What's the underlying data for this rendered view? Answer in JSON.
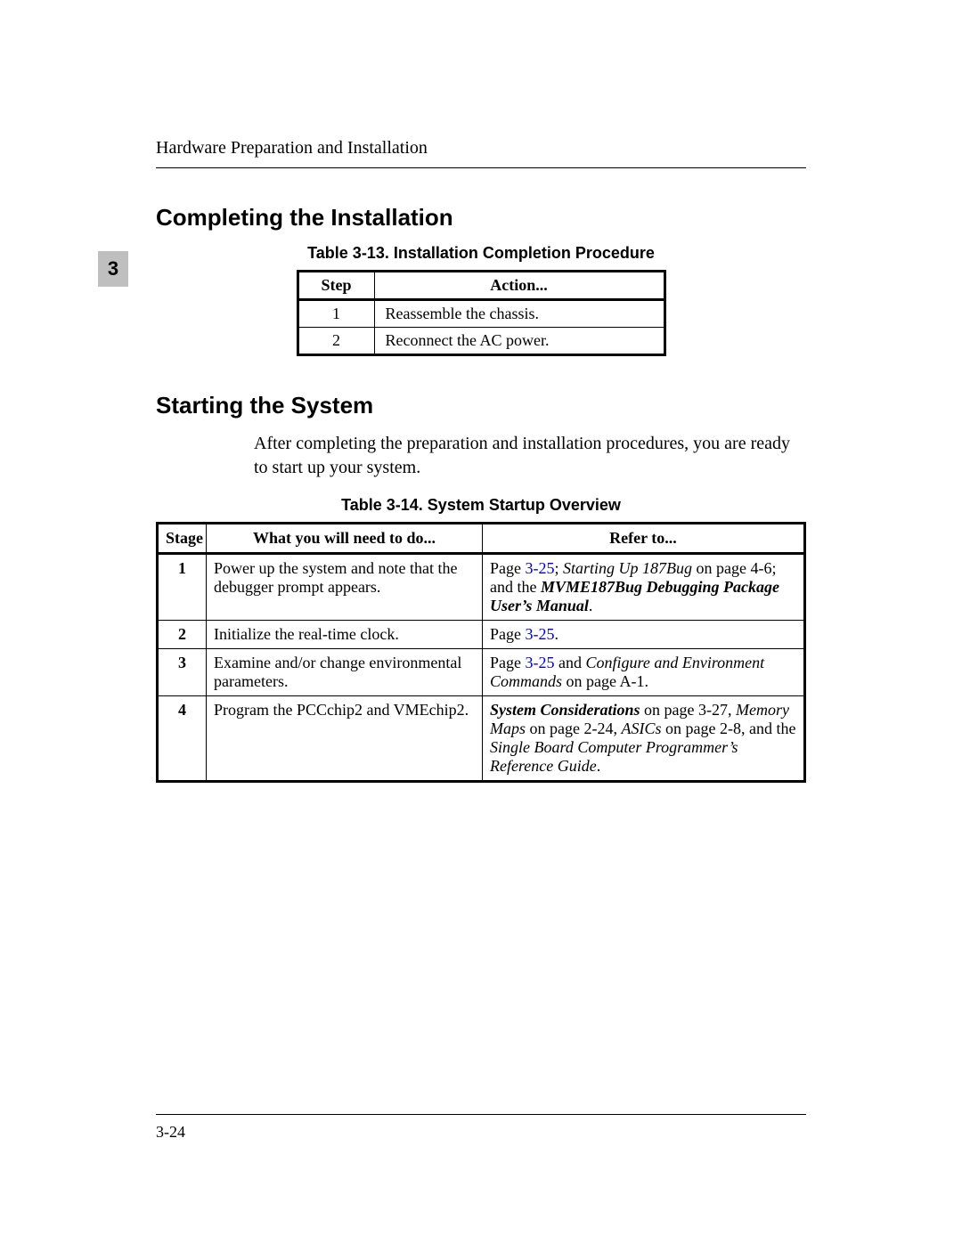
{
  "header": {
    "running_head": "Hardware Preparation and Installation"
  },
  "chapter_tab": "3",
  "section1": "Completing the Installation",
  "table13": {
    "caption": "Table 3-13.  Installation Completion Procedure",
    "head_step": "Step",
    "head_action": "Action...",
    "rows": [
      {
        "step": "1",
        "action": "Reassemble the chassis."
      },
      {
        "step": "2",
        "action": "Reconnect the AC power."
      }
    ]
  },
  "section2": "Starting the System",
  "body2": "After completing the preparation and installation procedures, you are ready to start up your system.",
  "table14": {
    "caption": "Table 3-14.  System Startup Overview",
    "head_stage": "Stage",
    "head_what": "What you will need to do...",
    "head_ref": "Refer to...",
    "rows": [
      {
        "stage": "1",
        "what": "Power up the system and note that the debugger prompt appears.",
        "ref": {
          "t1": "Page ",
          "l1": "3-25",
          "t2": "; ",
          "i1": "Starting Up 187Bug",
          "t3": " on page 4-6; and the ",
          "bi1": "MVME187Bug Debugging Package User’s Manual",
          "t4": "."
        }
      },
      {
        "stage": "2",
        "what": "Initialize the real-time clock.",
        "ref": {
          "t1": "Page ",
          "l1": "3-25",
          "t2": "."
        }
      },
      {
        "stage": "3",
        "what": "Examine and/or change environmental parameters.",
        "ref": {
          "t1": "Page ",
          "l1": "3-25",
          "t2": " and ",
          "i1": "Configure and Environment Commands",
          "t3": " on page A-1."
        }
      },
      {
        "stage": "4",
        "what": "Program the PCCchip2 and VMEchip2.",
        "ref": {
          "bi1": "System Considerations",
          "t1": " on page 3-27, ",
          "i1": "Memory Maps",
          "t2": " on page 2-24, ",
          "i2": "ASICs",
          "t3": " on page 2-8, and the ",
          "i3": "Single Board Computer Programmer’s Reference Guide",
          "t4": "."
        }
      }
    ]
  },
  "footer": {
    "page_number": "3-24"
  }
}
